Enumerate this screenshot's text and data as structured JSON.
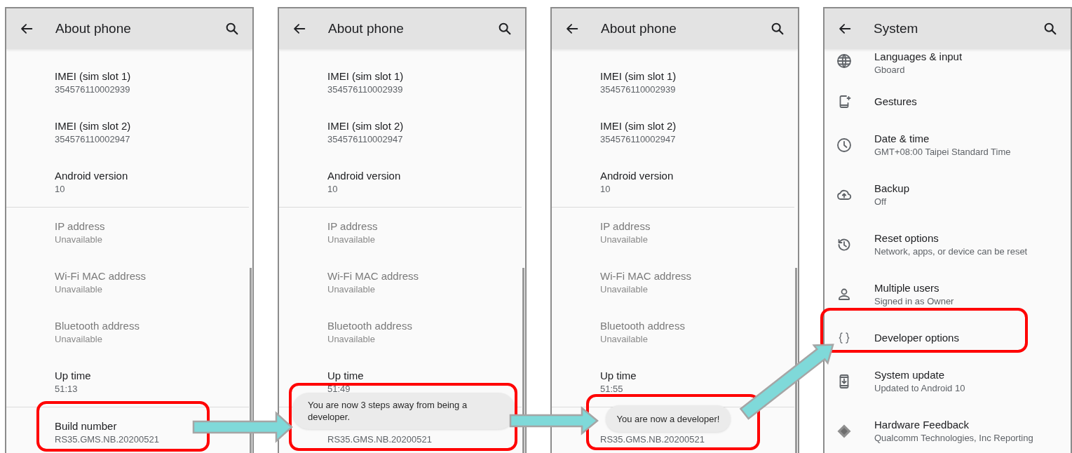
{
  "screens": [
    {
      "kind": "info",
      "title": "About phone",
      "sections": [
        [
          {
            "title": "IMEI (sim slot 1)",
            "value": "354576110002939",
            "disabled": false
          },
          {
            "title": "IMEI (sim slot 2)",
            "value": "354576110002947",
            "disabled": false
          },
          {
            "title": "Android version",
            "value": "10",
            "disabled": false
          }
        ],
        [
          {
            "title": "IP address",
            "value": "Unavailable",
            "disabled": true
          },
          {
            "title": "Wi-Fi MAC address",
            "value": "Unavailable",
            "disabled": true
          },
          {
            "title": "Bluetooth address",
            "value": "Unavailable",
            "disabled": true
          },
          {
            "title": "Up time",
            "value": "51:13",
            "disabled": false
          }
        ],
        [
          {
            "title": "Build number",
            "value": "RS35.GMS.NB.20200521",
            "disabled": false
          }
        ]
      ]
    },
    {
      "kind": "info",
      "title": "About phone",
      "toast": "You are now 3 steps away from being a developer.",
      "sections": [
        [
          {
            "title": "IMEI (sim slot 1)",
            "value": "354576110002939",
            "disabled": false
          },
          {
            "title": "IMEI (sim slot 2)",
            "value": "354576110002947",
            "disabled": false
          },
          {
            "title": "Android version",
            "value": "10",
            "disabled": false
          }
        ],
        [
          {
            "title": "IP address",
            "value": "Unavailable",
            "disabled": true
          },
          {
            "title": "Wi-Fi MAC address",
            "value": "Unavailable",
            "disabled": true
          },
          {
            "title": "Bluetooth address",
            "value": "Unavailable",
            "disabled": true
          },
          {
            "title": "Up time",
            "value": "51:49",
            "disabled": false
          }
        ],
        [
          {
            "value": "RS35.GMS.NB.20200521",
            "disabled": false
          }
        ]
      ]
    },
    {
      "kind": "info",
      "title": "About phone",
      "toast": "You are now a developer!",
      "sections": [
        [
          {
            "title": "IMEI (sim slot 1)",
            "value": "354576110002939",
            "disabled": false
          },
          {
            "title": "IMEI (sim slot 2)",
            "value": "354576110002947",
            "disabled": false
          },
          {
            "title": "Android version",
            "value": "10",
            "disabled": false
          }
        ],
        [
          {
            "title": "IP address",
            "value": "Unavailable",
            "disabled": true
          },
          {
            "title": "Wi-Fi MAC address",
            "value": "Unavailable",
            "disabled": true
          },
          {
            "title": "Bluetooth address",
            "value": "Unavailable",
            "disabled": true
          },
          {
            "title": "Up time",
            "value": "51:55",
            "disabled": false
          }
        ],
        [
          {
            "value": "RS35.GMS.NB.20200521",
            "disabled": false
          }
        ]
      ]
    },
    {
      "kind": "icons",
      "title": "System",
      "sections": [
        [
          {
            "title": "Languages & input",
            "value": "Gboard"
          },
          {
            "title": "Gestures"
          },
          {
            "title": "Date & time",
            "value": "GMT+08:00 Taipei Standard Time"
          },
          {
            "title": "Backup",
            "value": "Off"
          },
          {
            "title": "Reset options",
            "value": "Network, apps, or device can be reset"
          },
          {
            "title": "Multiple users",
            "value": "Signed in as Owner"
          },
          {
            "title": "Developer options"
          },
          {
            "title": "System update",
            "value": "Updated to Android 10"
          },
          {
            "title": "Hardware Feedback",
            "value": "Qualcomm Technologies, Inc Reporting"
          }
        ]
      ]
    }
  ]
}
